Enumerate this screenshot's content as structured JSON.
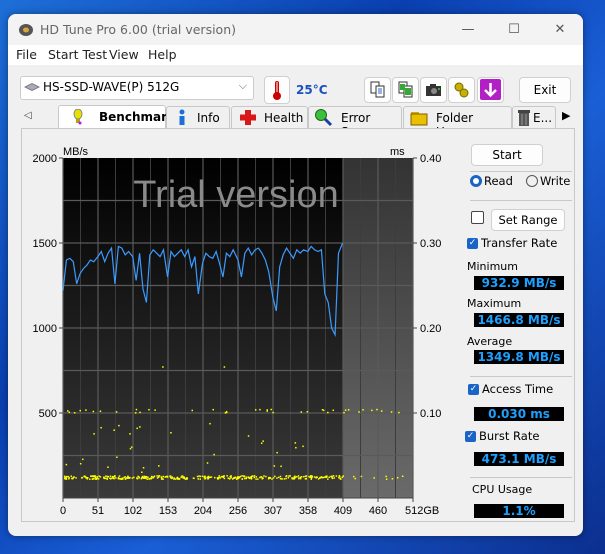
{
  "window": {
    "title": "HD Tune Pro 6.00 (trial version)",
    "controls": {
      "minimize": "—",
      "maximize": "☐",
      "close": "✕"
    }
  },
  "menu": [
    "File",
    "Start Test",
    "View",
    "Help"
  ],
  "toolbar": {
    "drive": "HS-SSD-WAVE(P) 512G",
    "temperature": "25°C",
    "icons": [
      "copy-text-icon",
      "copy-screenshot-icon",
      "camera-icon",
      "options-gears-icon",
      "save-download-icon"
    ],
    "exit_label": "Exit"
  },
  "tabs": [
    {
      "label": "Benchmark",
      "icon": "benchmark-bulb-icon",
      "active": true
    },
    {
      "label": "Info",
      "icon": "info-icon",
      "active": false
    },
    {
      "label": "Health",
      "icon": "health-cross-icon",
      "active": false
    },
    {
      "label": "Error Scan",
      "icon": "magnifier-icon",
      "active": false
    },
    {
      "label": "Folder Usage",
      "icon": "folder-icon",
      "active": false
    },
    {
      "label": "E...",
      "icon": "trash-icon",
      "active": false
    }
  ],
  "side_panel": {
    "start_label": "Start",
    "mode_options": [
      {
        "label": "Read",
        "selected": true
      },
      {
        "label": "Write",
        "selected": false
      }
    ],
    "set_range_checked": false,
    "set_range_label": "Set Range",
    "transfer_rate": {
      "label": "Transfer Rate",
      "checked": true
    },
    "minimum_label": "Minimum",
    "minimum": "932.9 MB/s",
    "maximum_label": "Maximum",
    "maximum": "1466.8 MB/s",
    "average_label": "Average",
    "average": "1349.8 MB/s",
    "access_time": {
      "label": "Access Time",
      "checked": true,
      "value": "0.030 ms"
    },
    "burst_rate": {
      "label": "Burst Rate",
      "checked": true,
      "value": "473.1 MB/s"
    },
    "cpu_usage_label": "CPU Usage",
    "cpu_usage": "1.1%"
  },
  "chart_data": {
    "type": "line",
    "watermark": "Trial version",
    "ylabel_left": "MB/s",
    "ylabel_right": "ms",
    "xlabel": "GB",
    "xlim": [
      0,
      512
    ],
    "ylim_left": [
      0,
      2000
    ],
    "ylim_right": [
      0,
      0.4
    ],
    "x_ticks": [
      "0",
      "51",
      "102",
      "153",
      "204",
      "256",
      "307",
      "358",
      "409",
      "460",
      "512GB"
    ],
    "y_ticks_left": [
      "2000",
      "1500",
      "1000",
      "500"
    ],
    "y_ticks_right": [
      "0.40",
      "0.30",
      "0.20",
      "0.10"
    ],
    "grid": true,
    "tested_until_gb": 409,
    "series": [
      {
        "name": "Transfer Rate",
        "color": "#3c9bff",
        "unit": "MB/s",
        "x": [
          0,
          5,
          10,
          15,
          20,
          25,
          30,
          35,
          40,
          45,
          51,
          56,
          61,
          66,
          71,
          76,
          81,
          86,
          91,
          96,
          102,
          107,
          112,
          117,
          122,
          127,
          132,
          137,
          142,
          147,
          153,
          158,
          163,
          168,
          173,
          178,
          183,
          188,
          193,
          198,
          204,
          209,
          214,
          219,
          224,
          229,
          234,
          239,
          244,
          249,
          256,
          261,
          266,
          271,
          276,
          281,
          286,
          291,
          296,
          301,
          307,
          312,
          317,
          322,
          327,
          332,
          337,
          342,
          347,
          352,
          358,
          363,
          368,
          373,
          378,
          383,
          388,
          393,
          398,
          403,
          409
        ],
        "values": [
          1220,
          1400,
          1410,
          1390,
          1260,
          1320,
          1350,
          1370,
          1400,
          1390,
          1420,
          1450,
          1390,
          1440,
          1470,
          1260,
          1480,
          1470,
          1430,
          1450,
          1420,
          1280,
          1440,
          1230,
          1150,
          1430,
          1460,
          1440,
          1420,
          1460,
          1300,
          1450,
          1420,
          1440,
          1460,
          1420,
          1460,
          1360,
          1420,
          1200,
          1380,
          1440,
          1420,
          1410,
          1450,
          1380,
          1300,
          1440,
          1420,
          1460,
          1400,
          1300,
          1440,
          1470,
          1430,
          1460,
          1470,
          1440,
          1400,
          1330,
          1180,
          1100,
          1360,
          1430,
          1470,
          1440,
          1410,
          1460,
          1440,
          1460,
          1450,
          1480,
          1460,
          1450,
          1460,
          1200,
          1150,
          1000,
          960,
          1440,
          1500
        ]
      },
      {
        "name": "Access Time",
        "color": "#ffff00",
        "unit": "ms",
        "typical": 0.025,
        "cluster_secondary": 0.103,
        "max_outlier": 0.155
      }
    ]
  }
}
